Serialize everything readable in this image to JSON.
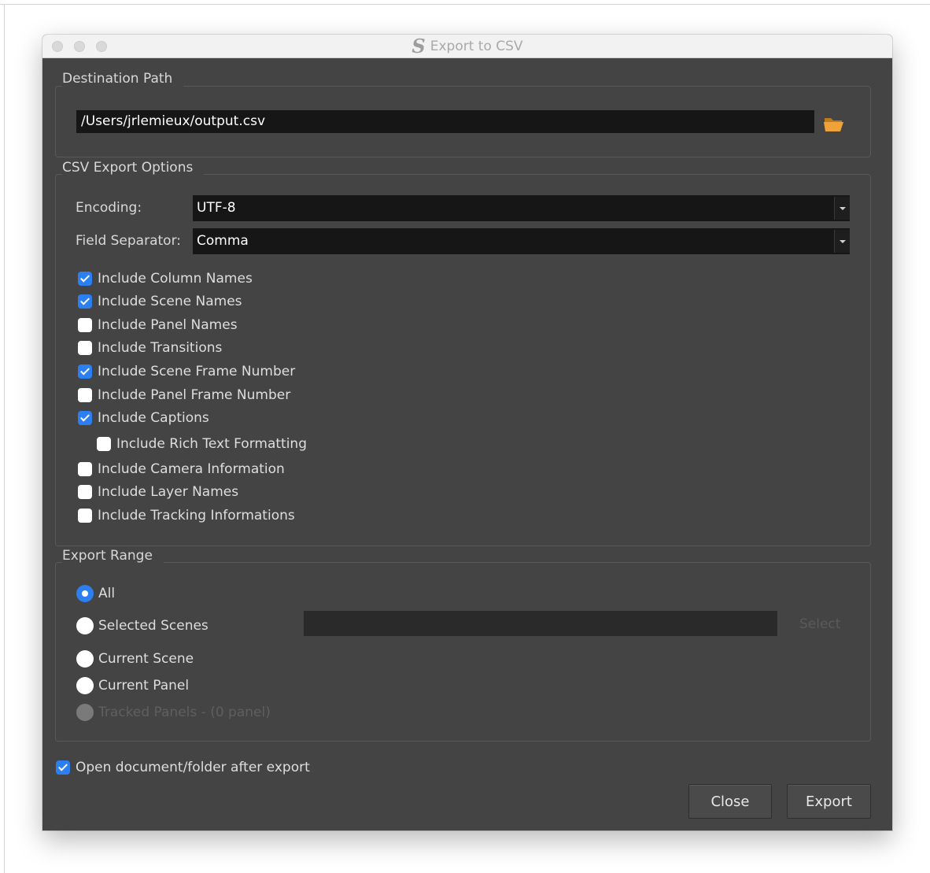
{
  "window": {
    "title": "Export to CSV",
    "app_logo": "S"
  },
  "destination": {
    "label": "Destination Path",
    "path": "/Users/jrlemieux/output.csv",
    "browse_icon": "folder-open-icon"
  },
  "options": {
    "label": "CSV Export Options",
    "encoding": {
      "label": "Encoding:",
      "value": "UTF-8"
    },
    "separator": {
      "label": "Field Separator:",
      "value": "Comma"
    },
    "checkboxes": [
      {
        "label": "Include Column Names",
        "checked": true
      },
      {
        "label": "Include Scene Names",
        "checked": true
      },
      {
        "label": "Include Panel Names",
        "checked": false
      },
      {
        "label": "Include Transitions",
        "checked": false
      },
      {
        "label": "Include Scene Frame Number",
        "checked": true
      },
      {
        "label": "Include Panel Frame Number",
        "checked": false
      },
      {
        "label": "Include Captions",
        "checked": true
      },
      {
        "label": "Include Rich Text Formatting",
        "checked": false
      },
      {
        "label": "Include Camera Information",
        "checked": false
      },
      {
        "label": "Include Layer Names",
        "checked": false
      },
      {
        "label": "Include Tracking Informations",
        "checked": false
      }
    ]
  },
  "range": {
    "label": "Export Range",
    "radios": [
      {
        "label": "All",
        "selected": true,
        "enabled": true
      },
      {
        "label": "Selected Scenes",
        "selected": false,
        "enabled": true
      },
      {
        "label": "Current Scene",
        "selected": false,
        "enabled": true
      },
      {
        "label": "Current Panel",
        "selected": false,
        "enabled": true
      },
      {
        "label": "Tracked Panels - (0 panel)",
        "selected": false,
        "enabled": false
      }
    ],
    "scene_field_value": "",
    "select_label": "Select"
  },
  "open_after_export": {
    "label": "Open document/folder after export",
    "checked": true
  },
  "buttons": {
    "close": "Close",
    "export": "Export"
  },
  "colors": {
    "accent": "#2b7ff0",
    "panel": "#444444",
    "field": "#161616",
    "folder_icon": "#f0a23a"
  }
}
